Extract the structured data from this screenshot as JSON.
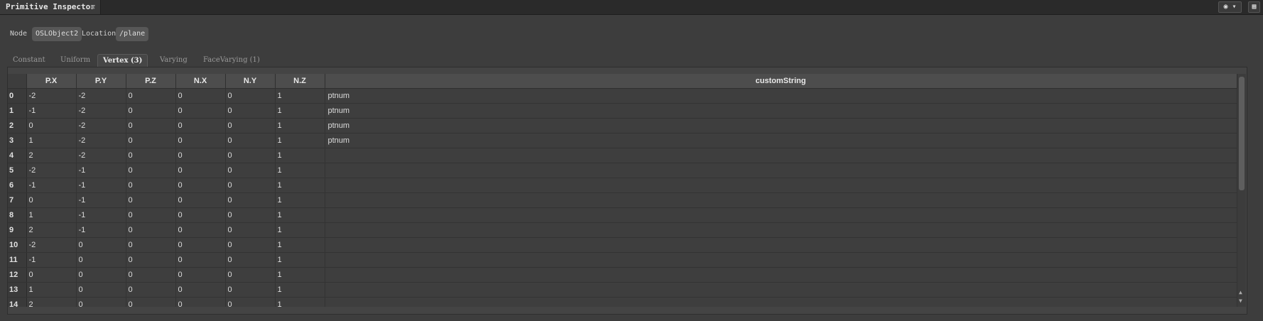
{
  "window": {
    "tab_title": "Primitive Inspector",
    "close_glyph": "✖"
  },
  "toolbar": {
    "target_glyph": "◉ ▾",
    "layout_glyph": "▦"
  },
  "node_row": {
    "node_label": "Node",
    "node_value": "OSLObject2",
    "location_label": "Location",
    "location_value": "/plane"
  },
  "tabs": [
    {
      "label": "Constant",
      "active": false
    },
    {
      "label": "Uniform",
      "active": false
    },
    {
      "label": "Vertex (3)",
      "active": true
    },
    {
      "label": "Varying",
      "active": false
    },
    {
      "label": "FaceVarying (1)",
      "active": false
    }
  ],
  "table": {
    "columns": [
      "P.X",
      "P.Y",
      "P.Z",
      "N.X",
      "N.Y",
      "N.Z",
      "customString"
    ],
    "rows": [
      {
        "index": "0",
        "cells": [
          "-2",
          "-2",
          "0",
          "0",
          "0",
          "1",
          "ptnum"
        ]
      },
      {
        "index": "1",
        "cells": [
          "-1",
          "-2",
          "0",
          "0",
          "0",
          "1",
          "ptnum"
        ]
      },
      {
        "index": "2",
        "cells": [
          "0",
          "-2",
          "0",
          "0",
          "0",
          "1",
          "ptnum"
        ]
      },
      {
        "index": "3",
        "cells": [
          "1",
          "-2",
          "0",
          "0",
          "0",
          "1",
          "ptnum"
        ]
      },
      {
        "index": "4",
        "cells": [
          "2",
          "-2",
          "0",
          "0",
          "0",
          "1",
          ""
        ]
      },
      {
        "index": "5",
        "cells": [
          "-2",
          "-1",
          "0",
          "0",
          "0",
          "1",
          ""
        ]
      },
      {
        "index": "6",
        "cells": [
          "-1",
          "-1",
          "0",
          "0",
          "0",
          "1",
          ""
        ]
      },
      {
        "index": "7",
        "cells": [
          "0",
          "-1",
          "0",
          "0",
          "0",
          "1",
          ""
        ]
      },
      {
        "index": "8",
        "cells": [
          "1",
          "-1",
          "0",
          "0",
          "0",
          "1",
          ""
        ]
      },
      {
        "index": "9",
        "cells": [
          "2",
          "-1",
          "0",
          "0",
          "0",
          "1",
          ""
        ]
      },
      {
        "index": "10",
        "cells": [
          "-2",
          "0",
          "0",
          "0",
          "0",
          "1",
          ""
        ]
      },
      {
        "index": "11",
        "cells": [
          "-1",
          "0",
          "0",
          "0",
          "0",
          "1",
          ""
        ]
      },
      {
        "index": "12",
        "cells": [
          "0",
          "0",
          "0",
          "0",
          "0",
          "1",
          ""
        ]
      },
      {
        "index": "13",
        "cells": [
          "1",
          "0",
          "0",
          "0",
          "0",
          "1",
          ""
        ]
      },
      {
        "index": "14",
        "cells": [
          "2",
          "0",
          "0",
          "0",
          "0",
          "1",
          ""
        ]
      }
    ]
  },
  "scrollbar": {
    "up_glyph": "▲",
    "down_glyph": "▼"
  }
}
